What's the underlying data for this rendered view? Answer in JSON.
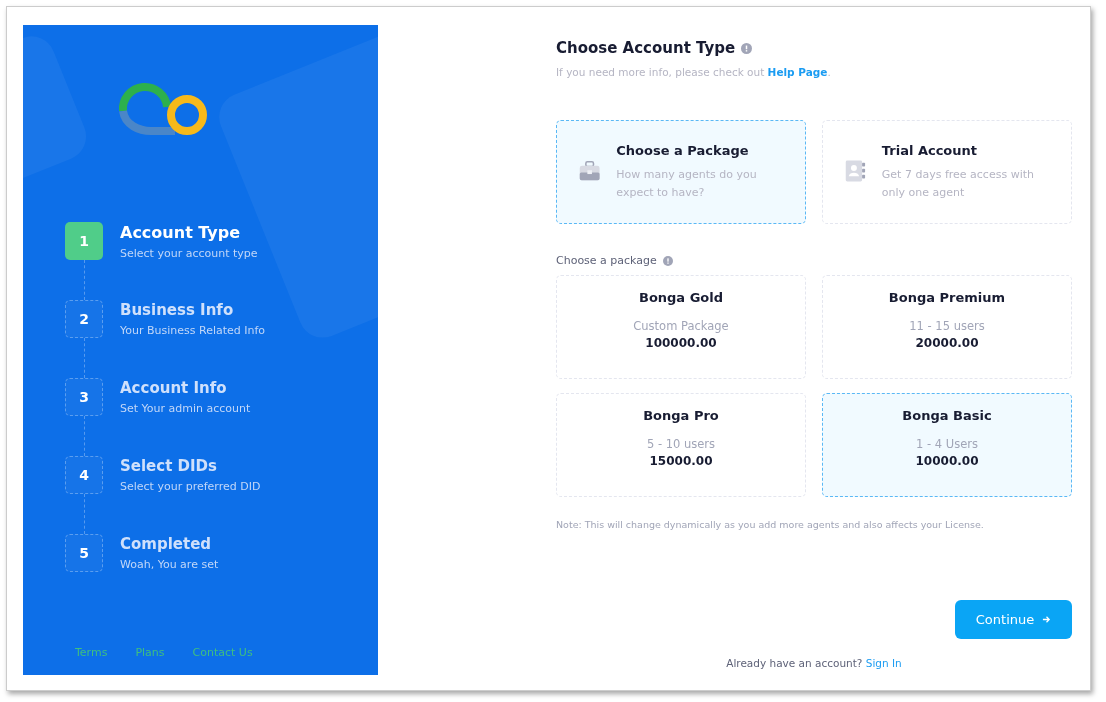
{
  "sidebar": {
    "steps": [
      {
        "number": "1",
        "title": "Account Type",
        "subtitle": "Select your account type",
        "selected": true
      },
      {
        "number": "2",
        "title": "Business Info",
        "subtitle": "Your Business Related Info",
        "selected": false
      },
      {
        "number": "3",
        "title": "Account Info",
        "subtitle": "Set Your admin account",
        "selected": false
      },
      {
        "number": "4",
        "title": "Select DIDs",
        "subtitle": "Select your preferred DID",
        "selected": false
      },
      {
        "number": "5",
        "title": "Completed",
        "subtitle": "Woah, You are set",
        "selected": false
      }
    ],
    "footer_links": [
      "Terms",
      "Plans",
      "Contact Us"
    ]
  },
  "main": {
    "title": "Choose Account Type",
    "subtitle": "If you need more info, please check out",
    "help_link": "Help Page",
    "subtitle_end": ".",
    "account_types": [
      {
        "kind": "package",
        "title": "Choose a Package",
        "description": "How many agents do you expect to have?",
        "selected": true
      },
      {
        "kind": "trial",
        "title": "Trial Account",
        "description": "Get 7 days free access with only one agent",
        "selected": false
      }
    ],
    "packages_label": "Choose a package",
    "packages": [
      {
        "name": "Bonga Gold",
        "users": "Custom Package",
        "price": "100000.00",
        "selected": false
      },
      {
        "name": "Bonga Premium",
        "users": "11 - 15 users",
        "price": "20000.00",
        "selected": false
      },
      {
        "name": "Bonga Pro",
        "users": "5 - 10 users",
        "price": "15000.00",
        "selected": false
      },
      {
        "name": "Bonga Basic",
        "users": "1 - 4 Users",
        "price": "10000.00",
        "selected": true
      }
    ],
    "note": "Note: This will change dynamically as you add more agents and also affects your License.",
    "continue_button": "Continue",
    "signin_prompt": "Already have an account?",
    "signin_link": "Sign In"
  }
}
